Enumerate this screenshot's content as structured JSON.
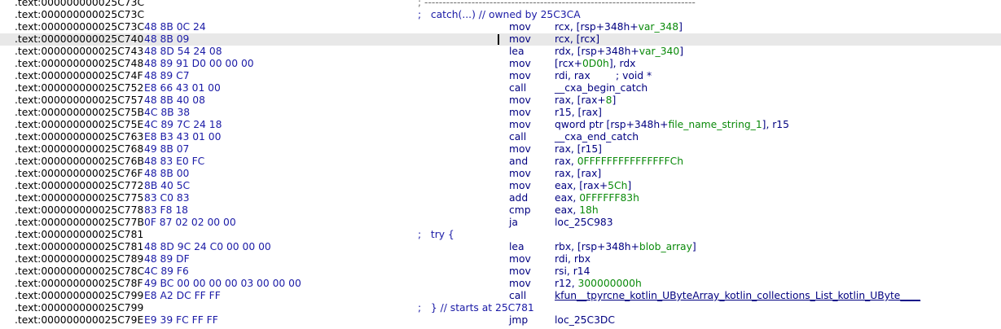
{
  "rows": [
    {
      "addr": ".text:000000000025C73C",
      "bytes": "",
      "sep": "; ---------------------------------------------------------------------------",
      "mnem": "",
      "ops": [],
      "comment": ""
    },
    {
      "addr": ".text:000000000025C73C",
      "bytes": "",
      "comment": ";   catch(...) // owned by 25C3CA",
      "mnem": "",
      "ops": []
    },
    {
      "addr": ".text:000000000025C73C",
      "bytes": "48 8B 0C 24",
      "mnem": "mov",
      "ops": [
        {
          "t": "rcx, [rsp+348h+"
        },
        {
          "t": "var_348",
          "c": "g"
        },
        {
          "t": "]"
        }
      ]
    },
    {
      "addr": ".text:000000000025C740",
      "bytes": "48 8B 09",
      "mnem": "mov",
      "ops": [
        {
          "t": "rcx, [rcx]"
        }
      ],
      "highlight": true,
      "caret": true
    },
    {
      "addr": ".text:000000000025C743",
      "bytes": "48 8D 54 24 08",
      "mnem": "lea",
      "ops": [
        {
          "t": "rdx, [rsp+348h+"
        },
        {
          "t": "var_340",
          "c": "g"
        },
        {
          "t": "]"
        }
      ]
    },
    {
      "addr": ".text:000000000025C748",
      "bytes": "48 89 91 D0 00 00 00",
      "mnem": "mov",
      "ops": [
        {
          "t": "[rcx+"
        },
        {
          "t": "0D0h",
          "c": "g"
        },
        {
          "t": "], rdx"
        }
      ]
    },
    {
      "addr": ".text:000000000025C74F",
      "bytes": "48 89 C7",
      "mnem": "mov",
      "ops": [
        {
          "t": "rdi, rax        ; void *",
          "c": "b"
        }
      ]
    },
    {
      "addr": ".text:000000000025C752",
      "bytes": "E8 66 43 01 00",
      "mnem": "call",
      "ops": [
        {
          "t": "__cxa_begin_catch"
        }
      ]
    },
    {
      "addr": ".text:000000000025C757",
      "bytes": "48 8B 40 08",
      "mnem": "mov",
      "ops": [
        {
          "t": "rax, [rax+"
        },
        {
          "t": "8",
          "c": "g"
        },
        {
          "t": "]"
        }
      ]
    },
    {
      "addr": ".text:000000000025C75B",
      "bytes": "4C 8B 38",
      "mnem": "mov",
      "ops": [
        {
          "t": "r15, [rax]"
        }
      ]
    },
    {
      "addr": ".text:000000000025C75E",
      "bytes": "4C 89 7C 24 18",
      "mnem": "mov",
      "ops": [
        {
          "t": "qword ptr [rsp+348h+"
        },
        {
          "t": "file_name_string_1",
          "c": "g"
        },
        {
          "t": "], r15"
        }
      ]
    },
    {
      "addr": ".text:000000000025C763",
      "bytes": "E8 B3 43 01 00",
      "mnem": "call",
      "ops": [
        {
          "t": "__cxa_end_catch"
        }
      ]
    },
    {
      "addr": ".text:000000000025C768",
      "bytes": "49 8B 07",
      "mnem": "mov",
      "ops": [
        {
          "t": "rax, [r15]"
        }
      ]
    },
    {
      "addr": ".text:000000000025C76B",
      "bytes": "48 83 E0 FC",
      "mnem": "and",
      "ops": [
        {
          "t": "rax, "
        },
        {
          "t": "0FFFFFFFFFFFFFFFCh",
          "c": "g"
        }
      ]
    },
    {
      "addr": ".text:000000000025C76F",
      "bytes": "48 8B 00",
      "mnem": "mov",
      "ops": [
        {
          "t": "rax, [rax]"
        }
      ]
    },
    {
      "addr": ".text:000000000025C772",
      "bytes": "8B 40 5C",
      "mnem": "mov",
      "ops": [
        {
          "t": "eax, [rax+"
        },
        {
          "t": "5Ch",
          "c": "g"
        },
        {
          "t": "]"
        }
      ]
    },
    {
      "addr": ".text:000000000025C775",
      "bytes": "83 C0 83",
      "mnem": "add",
      "ops": [
        {
          "t": "eax, "
        },
        {
          "t": "0FFFFFF83h",
          "c": "g"
        }
      ]
    },
    {
      "addr": ".text:000000000025C778",
      "bytes": "83 F8 18",
      "mnem": "cmp",
      "ops": [
        {
          "t": "eax, "
        },
        {
          "t": "18h",
          "c": "g"
        }
      ]
    },
    {
      "addr": ".text:000000000025C77B",
      "bytes": "0F 87 02 02 00 00",
      "mnem": "ja",
      "ops": [
        {
          "t": "loc_25C983"
        }
      ]
    },
    {
      "addr": ".text:000000000025C781",
      "bytes": "",
      "comment": ";   try {",
      "mnem": "",
      "ops": []
    },
    {
      "addr": ".text:000000000025C781",
      "bytes": "48 8D 9C 24 C0 00 00 00",
      "mnem": "lea",
      "ops": [
        {
          "t": "rbx, [rsp+348h+"
        },
        {
          "t": "blob_array",
          "c": "g"
        },
        {
          "t": "]"
        }
      ]
    },
    {
      "addr": ".text:000000000025C789",
      "bytes": "48 89 DF",
      "mnem": "mov",
      "ops": [
        {
          "t": "rdi, rbx"
        }
      ]
    },
    {
      "addr": ".text:000000000025C78C",
      "bytes": "4C 89 F6",
      "mnem": "mov",
      "ops": [
        {
          "t": "rsi, r14"
        }
      ]
    },
    {
      "addr": ".text:000000000025C78F",
      "bytes": "49 BC 00 00 00 00 03 00 00 00",
      "mnem": "mov",
      "ops": [
        {
          "t": "r12, "
        },
        {
          "t": "300000000h",
          "c": "g"
        }
      ]
    },
    {
      "addr": ".text:000000000025C799",
      "bytes": "E8 A2 DC FF FF",
      "mnem": "call",
      "ops": [
        {
          "t": "kfun__tpyrcne_kotlin_UByteArray_kotlin_collections_List_kotlin_UByte____",
          "c": "u"
        }
      ]
    },
    {
      "addr": ".text:000000000025C799",
      "bytes": "",
      "comment": ";   } // starts at 25C781",
      "mnem": "",
      "ops": []
    },
    {
      "addr": ".text:000000000025C79E",
      "bytes": "E9 39 FC FF FF",
      "mnem": "jmp",
      "ops": [
        {
          "t": "loc_25C3DC"
        }
      ]
    }
  ],
  "colors": {
    "address": "#000000",
    "bytes": "#1a1aa6",
    "instruction": "#000080",
    "constant": "#0a8a0a",
    "comment": "#1a1aa6",
    "highlight": "#e8e8e8"
  }
}
